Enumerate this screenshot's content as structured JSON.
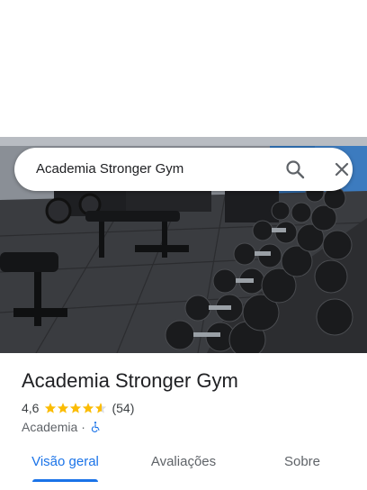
{
  "search": {
    "query": "Academia Stronger Gym"
  },
  "place": {
    "name": "Academia Stronger Gym",
    "rating": "4,6",
    "rating_stars": 4.6,
    "review_count": "(54)",
    "category": "Academia",
    "separator": "·"
  },
  "tabs": [
    {
      "label": "Visão geral",
      "active": true
    },
    {
      "label": "Avaliações",
      "active": false
    },
    {
      "label": "Sobre",
      "active": false
    }
  ],
  "colors": {
    "accent": "#1a73e8",
    "star": "#fbbc04",
    "text": "#202124"
  },
  "icons": {
    "search": "search-icon",
    "close": "close-icon",
    "accessibility": "wheelchair-icon",
    "star": "star-icon"
  }
}
